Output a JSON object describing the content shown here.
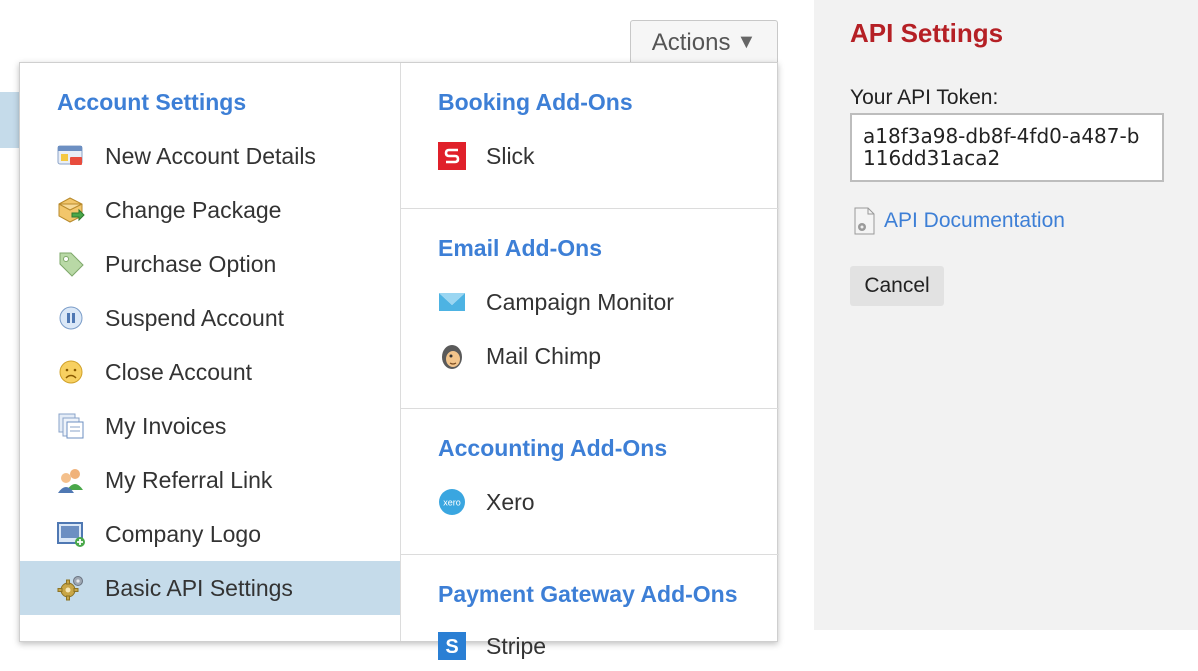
{
  "actions_button": {
    "label": "Actions",
    "caret": "▼"
  },
  "account_settings": {
    "title": "Account Settings",
    "items": [
      {
        "label": "New Account Details",
        "icon": "account-card-icon"
      },
      {
        "label": "Change Package",
        "icon": "package-icon"
      },
      {
        "label": "Purchase Option",
        "icon": "tag-icon"
      },
      {
        "label": "Suspend Account",
        "icon": "pause-icon"
      },
      {
        "label": "Close Account",
        "icon": "sad-face-icon"
      },
      {
        "label": "My Invoices",
        "icon": "invoices-icon"
      },
      {
        "label": "My Referral Link",
        "icon": "users-icon"
      },
      {
        "label": "Company Logo",
        "icon": "logo-image-icon"
      },
      {
        "label": "Basic API Settings",
        "icon": "gear-icon",
        "active": true
      }
    ]
  },
  "booking_addons": {
    "title": "Booking Add-Ons",
    "items": [
      {
        "label": "Slick",
        "icon": "slick-icon"
      }
    ]
  },
  "email_addons": {
    "title": "Email Add-Ons",
    "items": [
      {
        "label": "Campaign Monitor",
        "icon": "campaign-monitor-icon"
      },
      {
        "label": "Mail Chimp",
        "icon": "mailchimp-icon"
      }
    ]
  },
  "accounting_addons": {
    "title": "Accounting Add-Ons",
    "items": [
      {
        "label": "Xero",
        "icon": "xero-icon"
      }
    ]
  },
  "payment_addons": {
    "title": "Payment Gateway Add-Ons",
    "items": [
      {
        "label": "Stripe",
        "icon": "stripe-icon"
      }
    ]
  },
  "icon_text": {
    "xero": "xero",
    "stripe": "S"
  },
  "api_settings": {
    "title": "API Settings",
    "token_label": "Your API Token:",
    "token_value": "a18f3a98-db8f-4fd0-a487-b116dd31aca2",
    "doc_link": "API Documentation",
    "cancel_label": "Cancel"
  },
  "colors": {
    "link_blue": "#3d7fd6",
    "api_title_red": "#b52025",
    "active_row": "#c5dbea"
  }
}
